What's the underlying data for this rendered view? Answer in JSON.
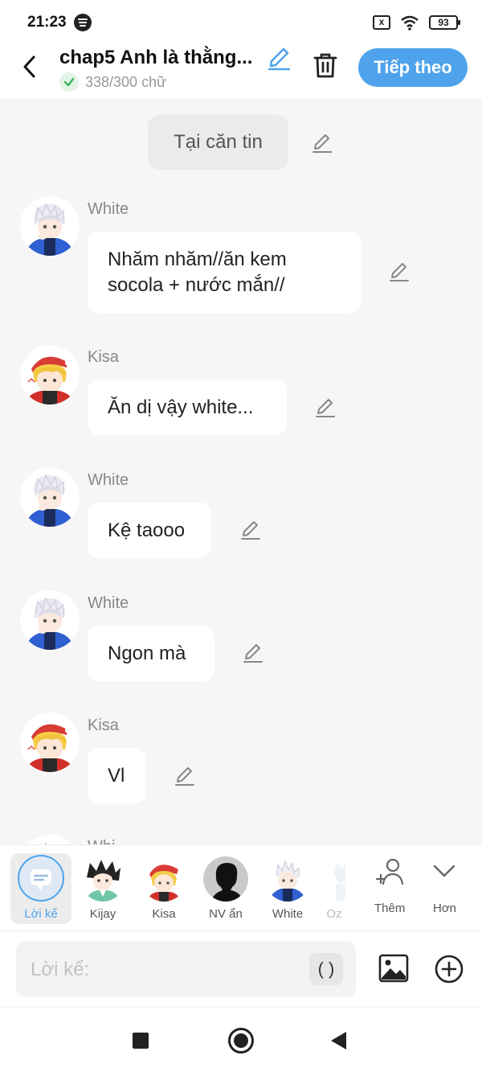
{
  "status_bar": {
    "time": "21:23",
    "battery": "93",
    "sim_icon": "x",
    "app_icon": "spotify-icon",
    "wifi_icon": "wifi-icon"
  },
  "header": {
    "title": "chap5 Anh là thằng...",
    "word_count": "338/300 chữ",
    "next_label": "Tiếp theo",
    "accent_color": "#4ea3ec"
  },
  "chat": {
    "narration": "Tại căn tin",
    "messages": [
      {
        "speaker": "White",
        "lines": [
          "Nhăm nhăm//ăn kem",
          "socola + nước mắn//"
        ]
      },
      {
        "speaker": "Kisa",
        "lines": [
          "Ăn dị vậy white..."
        ]
      },
      {
        "speaker": "White",
        "lines": [
          "Kệ taooo"
        ]
      },
      {
        "speaker": "White",
        "lines": [
          "Ngon mà"
        ]
      },
      {
        "speaker": "Kisa",
        "lines": [
          "Vl"
        ]
      }
    ],
    "partial_speaker": "Whi..."
  },
  "characters": [
    {
      "label": "Lời kể",
      "selected": true
    },
    {
      "label": "Kijay"
    },
    {
      "label": "Kisa"
    },
    {
      "label": "NV ẩn"
    },
    {
      "label": "White"
    },
    {
      "label": "Oz"
    }
  ],
  "char_actions": {
    "add_label": "Thêm",
    "more_label": "Hơn"
  },
  "input": {
    "placeholder": "Lời kể:",
    "paren_label": "( )"
  }
}
